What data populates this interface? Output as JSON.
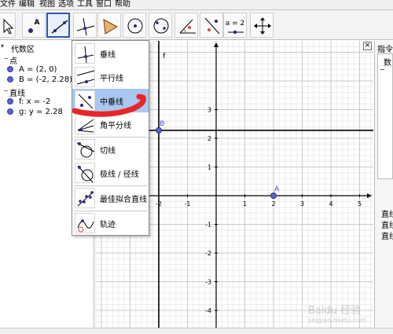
{
  "menu": {
    "items": [
      "文件",
      "编辑",
      "视图",
      "选项",
      "工具",
      "窗口",
      "帮助"
    ]
  },
  "toolbar": {
    "point_tool_label": "A",
    "slider_tool_label": "a = 2"
  },
  "algebra": {
    "title": "代数区",
    "groups": [
      {
        "label": "点",
        "items": [
          "A = (2, 0)",
          "B = (-2, 2.28)"
        ]
      },
      {
        "label": "直线",
        "items": [
          "f: x = -2",
          "g: y = 2.28"
        ]
      }
    ]
  },
  "dropdown": {
    "items": [
      {
        "label": "垂线",
        "icon": "perpendicular-line-icon"
      },
      {
        "label": "平行线",
        "icon": "parallel-line-icon"
      },
      {
        "label": "中垂线",
        "icon": "perpendicular-bisector-icon",
        "selected": true
      },
      {
        "label": "角平分线",
        "icon": "angle-bisector-icon"
      },
      {
        "label": "切线",
        "icon": "tangent-icon"
      },
      {
        "label": "极线 / 径线",
        "icon": "polar-line-icon"
      },
      {
        "label": "最佳拟合直线",
        "icon": "best-fit-line-icon"
      },
      {
        "label": "轨迹",
        "icon": "locus-icon"
      }
    ]
  },
  "graphics": {
    "y_axis_label": "f",
    "x_ticks": [
      "-2",
      "-1",
      "1",
      "2",
      "3",
      "4",
      "5"
    ],
    "y_ticks": [
      "3",
      "2",
      "1",
      "-1",
      "-2",
      "-3",
      "-4"
    ],
    "point_a_label": "A",
    "point_b_label": "B"
  },
  "right_panel": {
    "title": "指令",
    "header": "数",
    "rows": [
      "直线",
      "直线",
      "直线"
    ]
  },
  "watermark": {
    "text": "Baidu 经验",
    "sub": "jingyan.baidu.com"
  },
  "colors": {
    "point": "#5b63c9",
    "selected": "#a9c8ef",
    "marker": "#e8262a",
    "active_border": "#2a5aa8"
  }
}
